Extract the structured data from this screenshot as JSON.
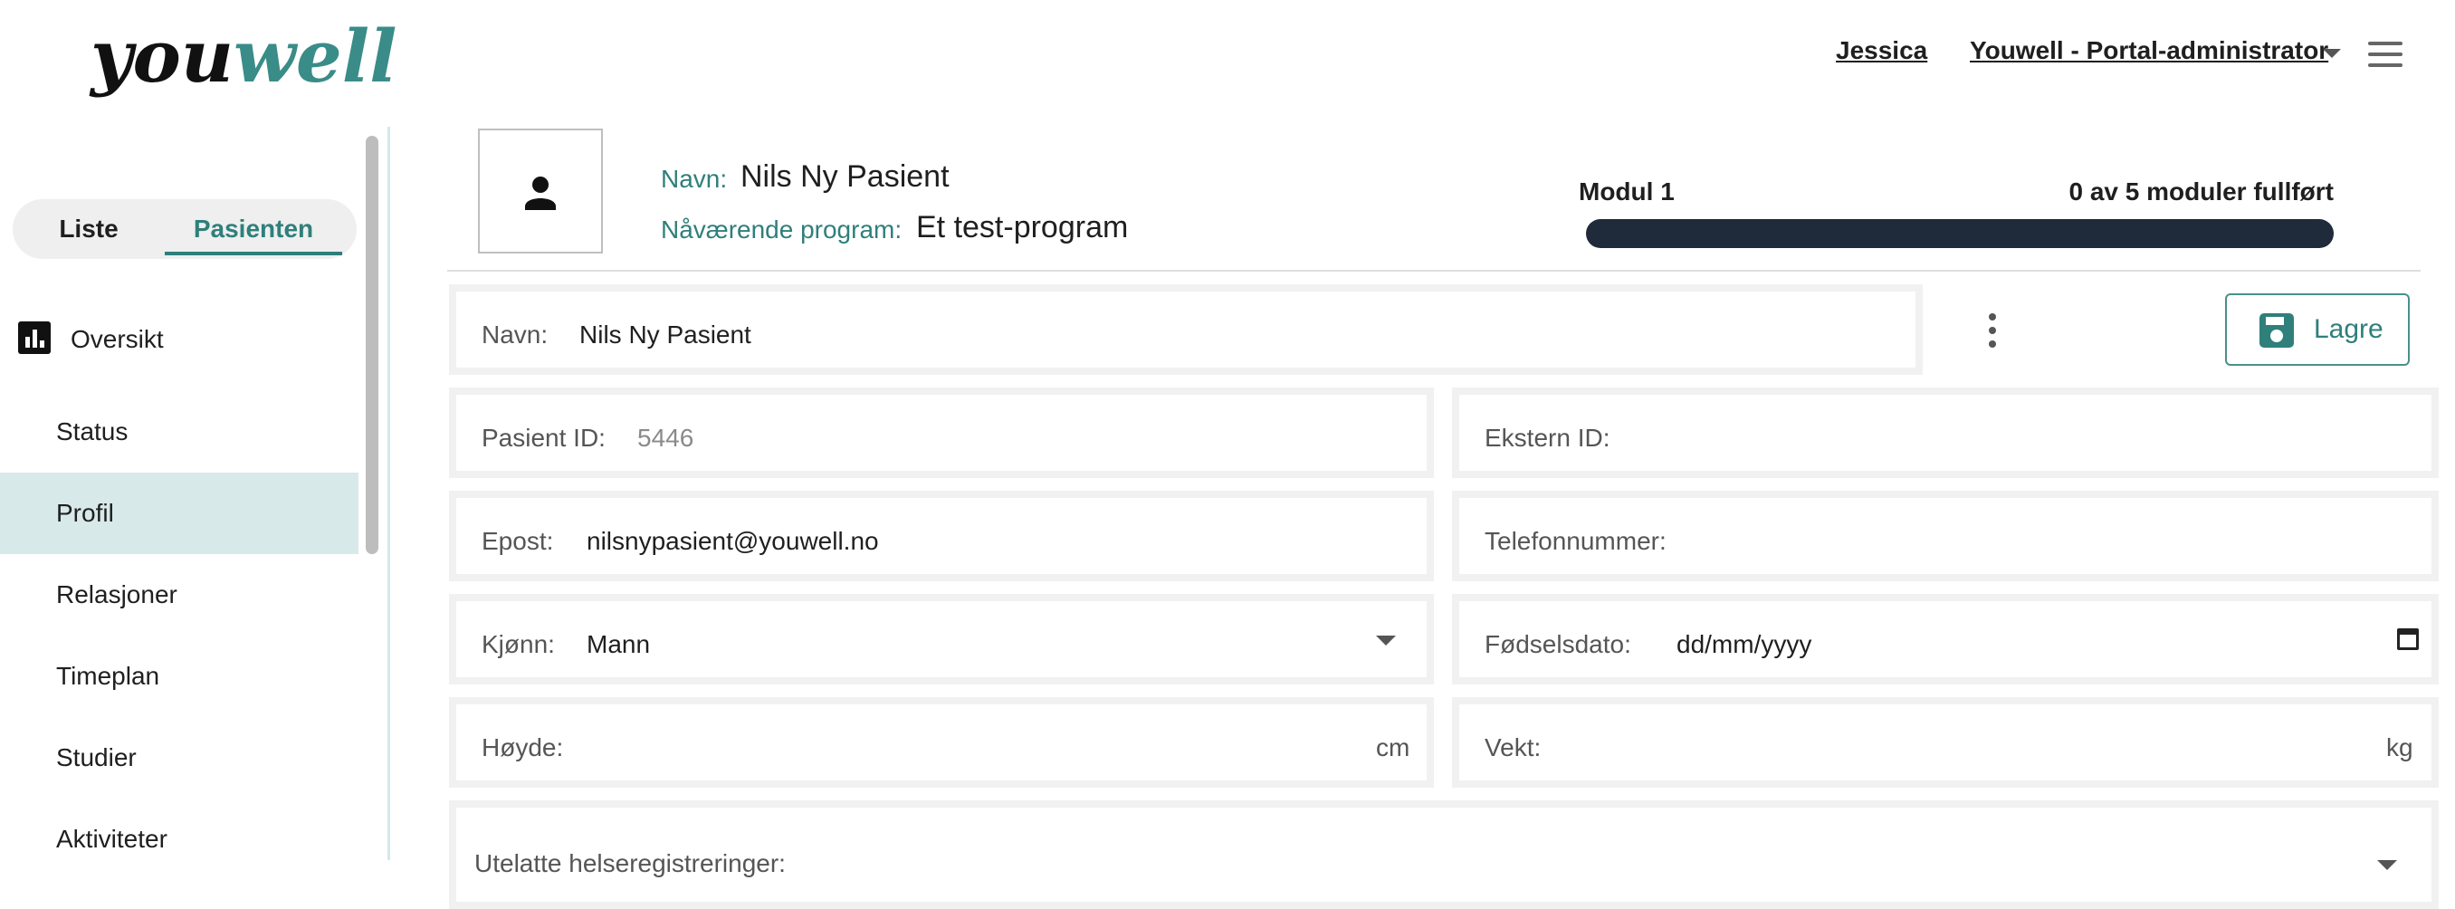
{
  "header": {
    "logo_you": "you",
    "logo_well": "well",
    "user_link": "Jessica",
    "role_select": "Youwell - Portal-administrator"
  },
  "sidebar": {
    "tabs": [
      {
        "label": "Liste",
        "active": false
      },
      {
        "label": "Pasienten",
        "active": true
      }
    ],
    "items": [
      {
        "label": "Oversikt",
        "icon": "bar-chart-icon"
      },
      {
        "label": "Status"
      },
      {
        "label": "Profil",
        "active": true
      },
      {
        "label": "Relasjoner"
      },
      {
        "label": "Timeplan"
      },
      {
        "label": "Studier"
      },
      {
        "label": "Aktiviteter"
      }
    ]
  },
  "banner": {
    "name_label": "Navn:",
    "name_value": "Nils Ny Pasient",
    "program_label": "Nåværende program:",
    "program_value": "Et test-program",
    "module_label": "Modul 1",
    "module_status": "0 av 5 moduler fullført",
    "progress_fraction": 0
  },
  "form": {
    "name": {
      "label": "Navn:",
      "value": "Nils Ny Pasient"
    },
    "save_label": "Lagre",
    "patient_id": {
      "label": "Pasient ID:",
      "value": "5446"
    },
    "external_id": {
      "label": "Ekstern ID:",
      "value": ""
    },
    "email": {
      "label": "Epost:",
      "value": "nilsnypasient@youwell.no"
    },
    "phone": {
      "label": "Telefonnummer:",
      "value": ""
    },
    "gender": {
      "label": "Kjønn:",
      "value": "Mann"
    },
    "birthdate": {
      "label": "Fødselsdato:",
      "placeholder": "dd/mm/yyyy"
    },
    "height": {
      "label": "Høyde:",
      "unit": "cm"
    },
    "weight": {
      "label": "Vekt:",
      "unit": "kg"
    },
    "omitted": {
      "label": "Utelatte helseregistreringer:"
    }
  },
  "colors": {
    "accent": "#2f7f7b",
    "active_nav_bg": "#d8e9ea",
    "progress_track": "#1f2b3a"
  }
}
